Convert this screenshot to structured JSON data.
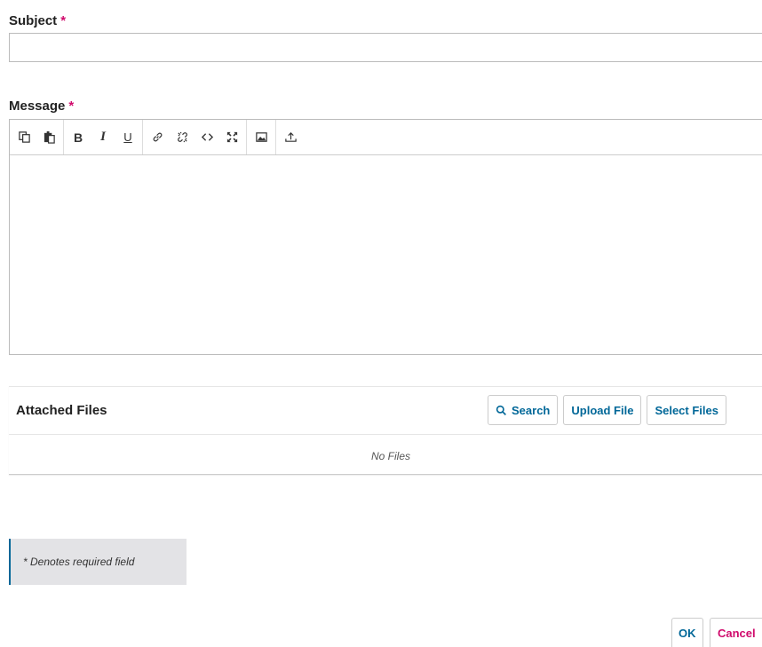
{
  "subject": {
    "label": "Subject",
    "required_mark": "*",
    "value": ""
  },
  "message": {
    "label": "Message",
    "required_mark": "*",
    "value": "",
    "toolbar": [
      {
        "icon": "copy-icon"
      },
      {
        "icon": "paste-icon"
      },
      {
        "icon": "bold-icon",
        "text": "B"
      },
      {
        "icon": "italic-icon",
        "text": "I"
      },
      {
        "icon": "underline-icon",
        "text": "U"
      },
      {
        "icon": "link-icon"
      },
      {
        "icon": "unlink-icon"
      },
      {
        "icon": "code-icon"
      },
      {
        "icon": "fullscreen-icon"
      },
      {
        "icon": "image-icon"
      },
      {
        "icon": "upload-icon"
      }
    ]
  },
  "attached_files": {
    "title": "Attached Files",
    "search_label": "Search",
    "upload_label": "Upload File",
    "select_label": "Select Files",
    "empty_text": "No Files"
  },
  "required_note": "* Denotes required field",
  "footer": {
    "ok_label": "OK",
    "cancel_label": "Cancel"
  },
  "colors": {
    "accent": "#006798",
    "required": "#d00a6c",
    "border": "#bbbbbb"
  }
}
